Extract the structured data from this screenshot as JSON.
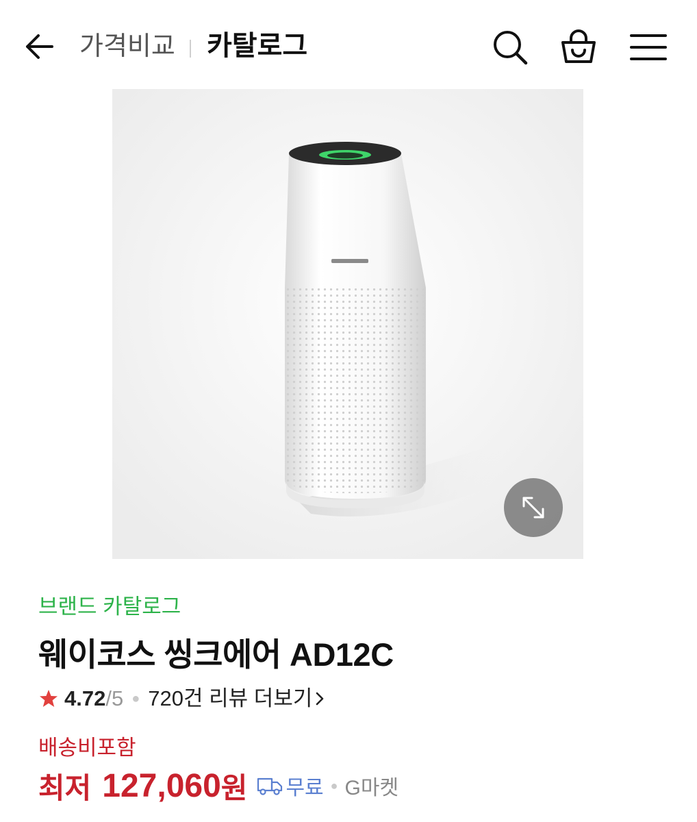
{
  "header": {
    "back_icon": "arrow-left-icon",
    "parent_label": "가격비교",
    "current_label": "카탈로그",
    "icons": [
      "search-icon",
      "shopping-bag-icon",
      "menu-icon"
    ]
  },
  "product": {
    "image_alt": "air purifier",
    "expand_icon": "expand-arrows-icon",
    "brand_link": "브랜드 카탈로그",
    "title": "웨이코스 씽크에어 AD12C",
    "rating": {
      "score": "4.72",
      "scale": "/5",
      "reviews": "720건 리뷰 더보기",
      "star_color": "#e2413e"
    },
    "shipping_label": "배송비포함",
    "price": {
      "prefix": "최저",
      "amount": "127,060",
      "unit": "원",
      "shipping": "무료",
      "seller": "G마켓"
    }
  },
  "colors": {
    "brand_green": "#2db34a",
    "price_red": "#c8222d",
    "free_blue": "#5a7fd0"
  }
}
